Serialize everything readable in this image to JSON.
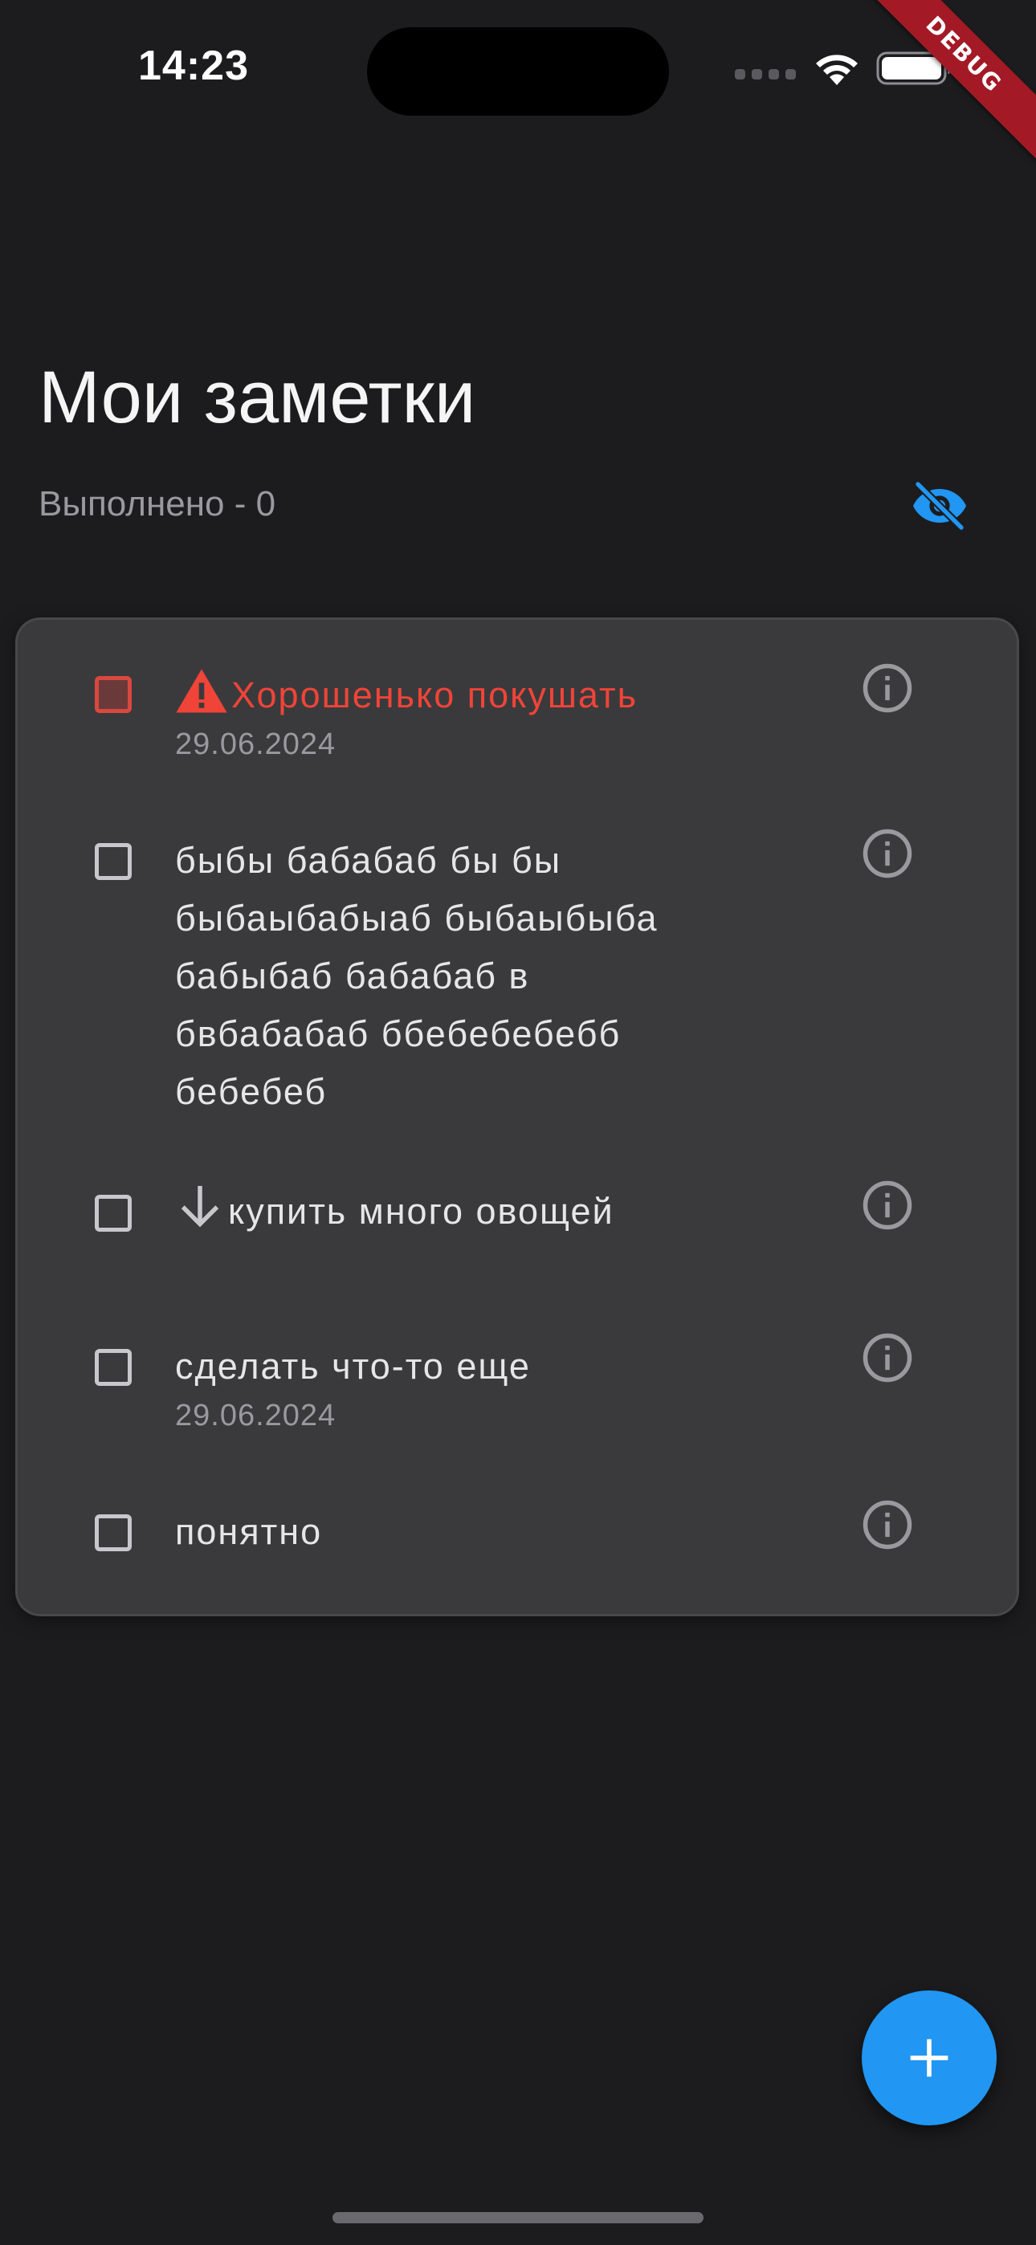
{
  "status_bar": {
    "time": "14:23"
  },
  "debug_banner": {
    "label": "DEBUG"
  },
  "header": {
    "title": "Мои заметки",
    "done_counter": "Выполнено - 0"
  },
  "icons": {
    "visibility_toggle": "eye-off-icon",
    "info": "info-outline-icon",
    "priority_high": "warning-icon",
    "priority_low": "arrow-down-icon",
    "add": "plus-icon"
  },
  "colors": {
    "background": "#1c1c1e",
    "card": "#3a3a3c",
    "accent": "#2196f3",
    "urgent": "#f04438",
    "secondary_text": "#9a9a9e"
  },
  "tasks": [
    {
      "text": "Хорошенько покушать",
      "date": "29.06.2024",
      "priority": "high",
      "done": false
    },
    {
      "text_lines": [
        "быбы бабабаб бы бы",
        "быбаыбабыаб быбаыбыба",
        "бабыбаб бабабаб в",
        "бвбабабаб ббебебебебб",
        "бебебеб"
      ],
      "priority": "none",
      "done": false
    },
    {
      "text": "купить много овощей",
      "priority": "low",
      "done": false
    },
    {
      "text": "сделать что-то еще",
      "date": "29.06.2024",
      "priority": "none",
      "done": false
    },
    {
      "text": "понятно",
      "priority": "none",
      "done": false
    }
  ]
}
